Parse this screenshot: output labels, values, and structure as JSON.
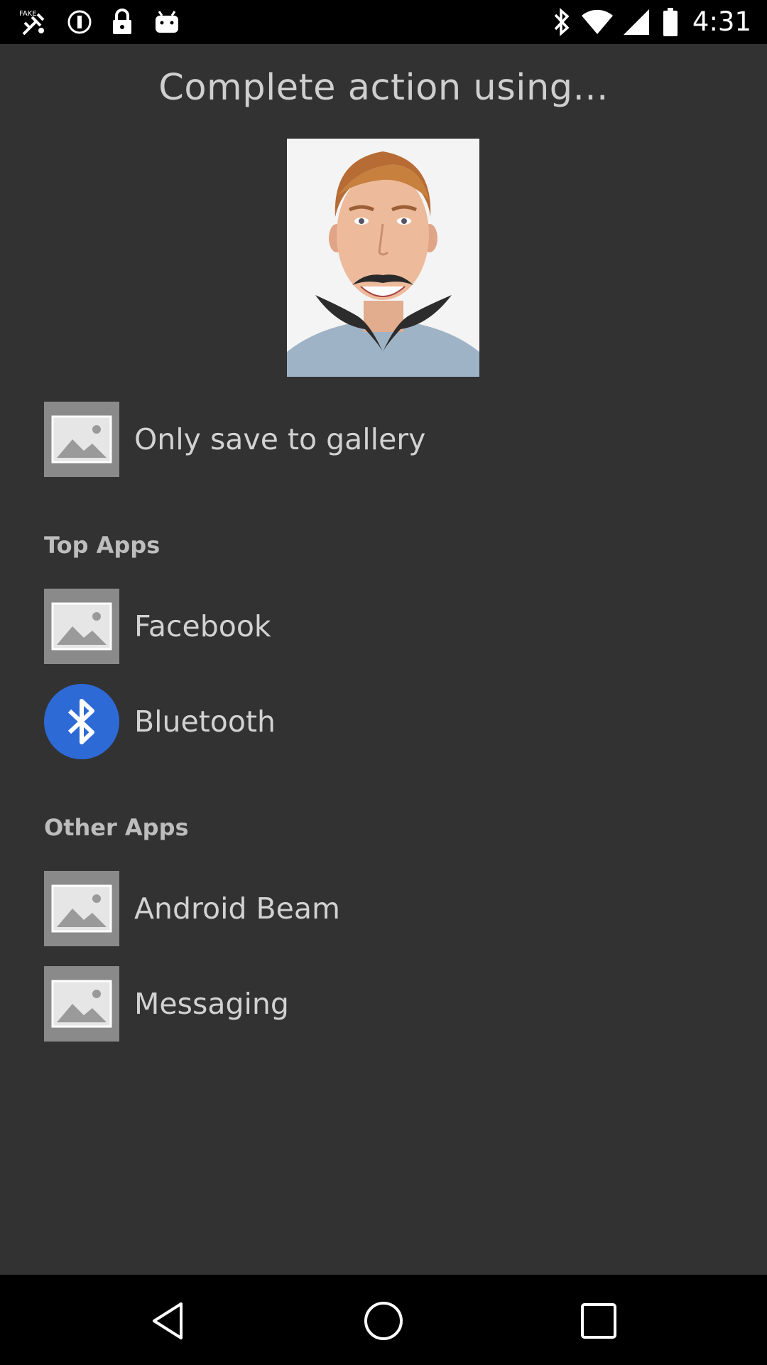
{
  "status_bar": {
    "time": "4:31",
    "left_icons": [
      "fake-gps-icon",
      "circle-alert-icon",
      "lock-icon",
      "android-icon"
    ],
    "right_icons": [
      "bluetooth-icon",
      "wifi-icon",
      "cellular-icon",
      "battery-icon"
    ]
  },
  "dialog": {
    "title": "Complete action using...",
    "preview_image": "face-with-beard-photo",
    "primary_option": {
      "label": "Only save to gallery",
      "icon": "image-placeholder-icon"
    },
    "sections": [
      {
        "header": "Top Apps",
        "items": [
          {
            "label": "Facebook",
            "icon": "image-placeholder-icon"
          },
          {
            "label": "Bluetooth",
            "icon": "bluetooth-icon"
          }
        ]
      },
      {
        "header": "Other Apps",
        "items": [
          {
            "label": "Android Beam",
            "icon": "image-placeholder-icon"
          },
          {
            "label": "Messaging",
            "icon": "image-placeholder-icon"
          }
        ]
      }
    ]
  },
  "nav_bar": {
    "buttons": [
      "back-icon",
      "home-icon",
      "recents-icon"
    ]
  },
  "colors": {
    "background": "#323232",
    "bluetooth_accent": "#2e6ad6",
    "thumb": "#8a8a8a"
  }
}
